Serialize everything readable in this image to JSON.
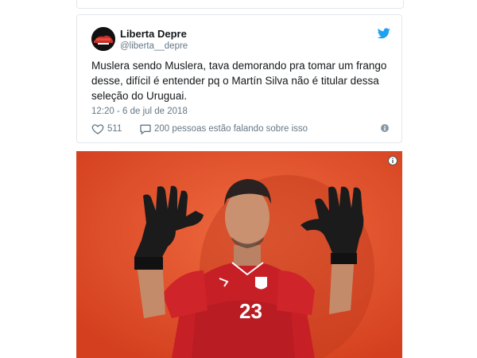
{
  "tweet": {
    "display_name": "Liberta Depre",
    "handle": "@liberta__depre",
    "text": "Muslera sendo Muslera, tava demorando pra tomar um frango desse, difícil é entender pq o Martín Silva não é titular dessa seleção do Uruguai.",
    "timestamp": "12:20 - 6 de jul de 2018",
    "likes": "511",
    "talking": "200 pessoas estão falando sobre isso",
    "icons": {
      "avatar": "avatar-logo",
      "brand": "twitter-bird-icon",
      "like": "heart-icon",
      "reply": "speech-bubble-icon",
      "info": "info-icon"
    },
    "colors": {
      "brand": "#1da1f2",
      "text": "#14171a",
      "muted": "#657786"
    }
  },
  "photo": {
    "jersey_number": "23",
    "background_color": "#e5532e"
  }
}
